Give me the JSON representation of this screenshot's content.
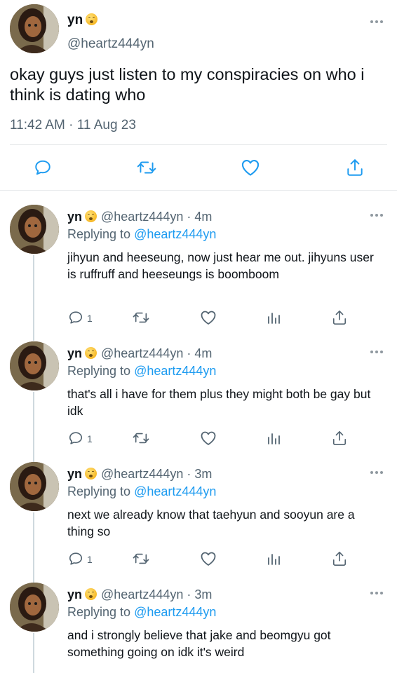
{
  "main_tweet": {
    "display_name": "yn",
    "handle": "@heartz444yn",
    "text": "okay guys just listen to my conspiracies on who i think is dating who",
    "timestamp": "11:42 AM · 11 Aug 23",
    "actions": [
      "reply-icon",
      "retweet-icon",
      "like-icon",
      "share-icon"
    ]
  },
  "replies": [
    {
      "display_name": "yn",
      "handle": "@heartz444yn · 4m",
      "replying_prefix": "Replying to ",
      "replying_to": "@heartz444yn",
      "text": "jihyun and heeseung, now just hear me out. jihyuns user is ruffruff and heeseungs is boomboom",
      "reply_count": "1"
    },
    {
      "display_name": "yn",
      "handle": "@heartz444yn · 4m",
      "replying_prefix": "Replying to ",
      "replying_to": "@heartz444yn",
      "text": "that's all i have for them plus they might both be gay but idk",
      "reply_count": "1"
    },
    {
      "display_name": "yn",
      "handle": "@heartz444yn · 3m",
      "replying_prefix": "Replying to ",
      "replying_to": "@heartz444yn",
      "text": "next we already know that taehyun and sooyun are a thing so",
      "reply_count": "1"
    },
    {
      "display_name": "yn",
      "handle": "@heartz444yn · 3m",
      "replying_prefix": "Replying to ",
      "replying_to": "@heartz444yn",
      "text": "and i strongly believe that jake and beomgyu got something going on idk it's weird",
      "reply_count": ""
    }
  ],
  "colors": {
    "link": "#1d9bf0",
    "muted": "#536471",
    "icon": "#536471",
    "text": "#0f1419"
  }
}
